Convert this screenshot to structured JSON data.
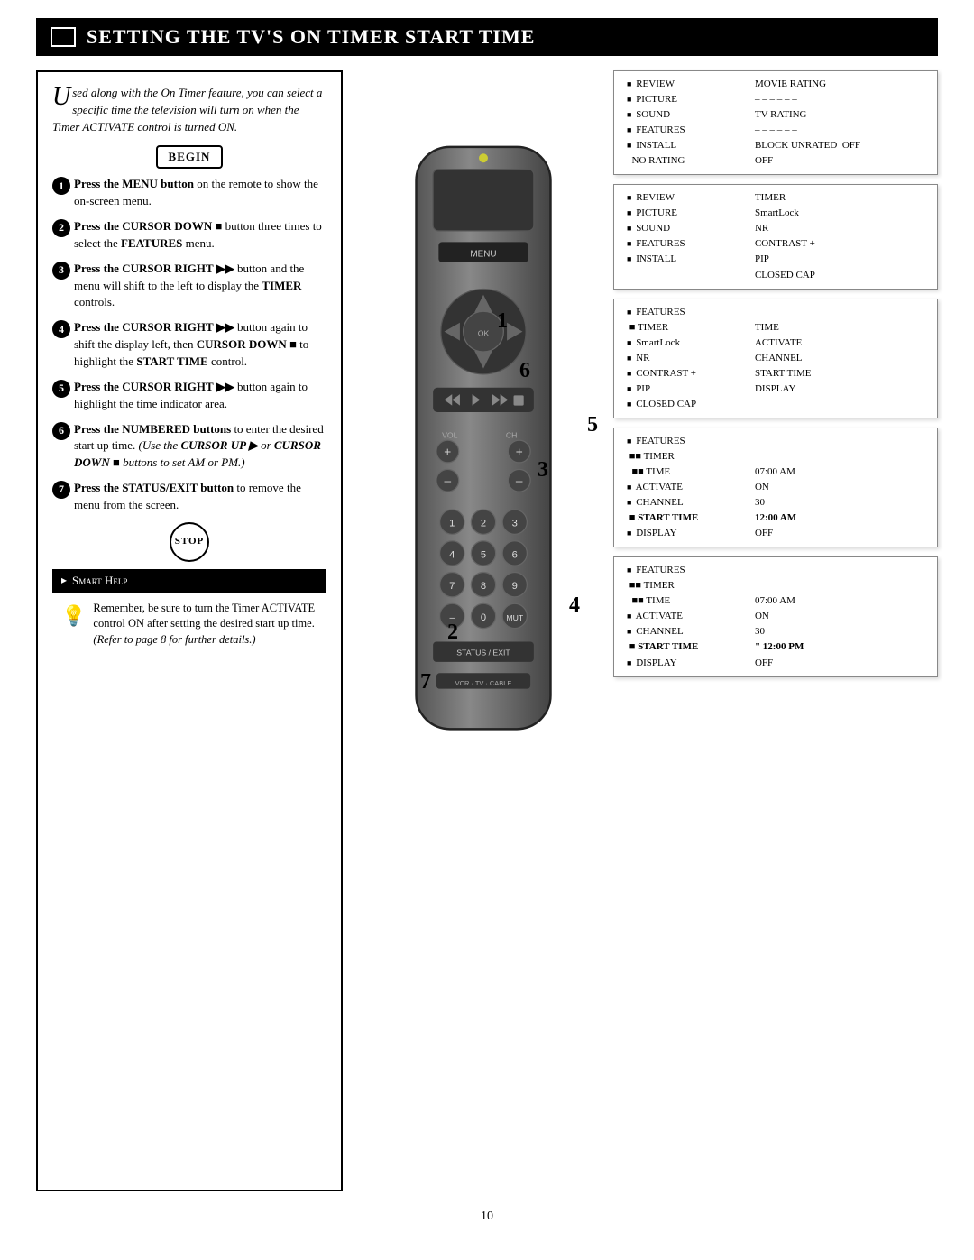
{
  "title": {
    "main": "Setting the TV's On Timer Start Time",
    "page_number": "10"
  },
  "left_panel": {
    "intro": "sed along with the On Timer feature, you can select a specific time the television will turn on when the Timer ACTIVATE control is turned ON.",
    "begin_label": "BEGIN",
    "stop_label": "STOP",
    "steps": [
      {
        "num": "1",
        "text": "Press the MENU button on the remote to show the on-screen menu."
      },
      {
        "num": "2",
        "text": "Press the CURSOR DOWN ■ button three times to select the FEATURES menu."
      },
      {
        "num": "3",
        "text": "Press the CURSOR RIGHT ▶▶ button and the menu will shift to the left to display the TIMER controls."
      },
      {
        "num": "4",
        "text": "Press the CURSOR RIGHT ▶▶ button again to shift the display left, then CURSOR DOWN ■ to highlight the START TIME control."
      },
      {
        "num": "5",
        "text": "Press the CURSOR RIGHT ▶▶ button again to highlight the time indicator area."
      },
      {
        "num": "6",
        "text": "Press the NUMBERED buttons to enter the desired start up time. (Use the CURSOR UP ▶ or CURSOR DOWN ■ buttons to set AM or PM.)"
      },
      {
        "num": "7",
        "text": "Press the STATUS/EXIT button to remove the menu from the screen."
      }
    ],
    "smart_help": {
      "title": "Smart Help",
      "text": "Remember, be sure to turn the Timer ACTIVATE control ON after setting the desired start up time.",
      "footnote": "(Refer to page 8 for further details.)"
    }
  },
  "menu_screens": [
    {
      "id": "screen1",
      "rows": [
        {
          "bullet": "■",
          "label": "REVIEW",
          "value": "MOVIE RATING"
        },
        {
          "bullet": "■",
          "label": "PICTURE",
          "value": "– – – – – –"
        },
        {
          "bullet": "■",
          "label": "SOUND",
          "value": "TV RATING"
        },
        {
          "bullet": "■",
          "label": "FEATURES",
          "value": "– – – – – –"
        },
        {
          "bullet": "■",
          "label": "INSTALL",
          "value": "BLOCK UNRATED OFF"
        },
        {
          "bullet": "",
          "label": "NO RATING",
          "value": "OFF"
        }
      ]
    },
    {
      "id": "screen2",
      "rows": [
        {
          "bullet": "■",
          "label": "REVIEW",
          "value": "TIMER"
        },
        {
          "bullet": "■",
          "label": "PICTURE",
          "value": "SmartLock"
        },
        {
          "bullet": "■",
          "label": "SOUND",
          "value": "NR"
        },
        {
          "bullet": "■",
          "label": "FEATURES",
          "value": "CONTRAST +"
        },
        {
          "bullet": "■",
          "label": "INSTALL",
          "value": "PIP"
        },
        {
          "bullet": "",
          "label": "",
          "value": "CLOSED CAP"
        }
      ]
    },
    {
      "id": "screen3",
      "rows": [
        {
          "bullet": "■",
          "label": "FEATURES",
          "value": ""
        },
        {
          "bullet": "■",
          "label": "TIMER",
          "value": "TIME"
        },
        {
          "bullet": "■",
          "label": "SmartLock",
          "value": "ACTIVATE"
        },
        {
          "bullet": "■",
          "label": "NR",
          "value": "CHANNEL"
        },
        {
          "bullet": "■",
          "label": "CONTRAST +",
          "value": "START TIME"
        },
        {
          "bullet": "■",
          "label": "PIP",
          "value": "DISPLAY"
        },
        {
          "bullet": "■",
          "label": "CLOSED CAP",
          "value": ""
        }
      ]
    },
    {
      "id": "screen4",
      "rows": [
        {
          "bullet": "■",
          "label": "FEATURES",
          "value": ""
        },
        {
          "bullet": "■■",
          "label": "TIMER",
          "value": ""
        },
        {
          "bullet": "■■",
          "label": "TIME",
          "value": "07:00 AM"
        },
        {
          "bullet": "■",
          "label": "ACTIVATE",
          "value": "ON"
        },
        {
          "bullet": "■",
          "label": "CHANNEL",
          "value": "30"
        },
        {
          "bullet": "■",
          "label": "START TIME",
          "value": "12:00 AM"
        },
        {
          "bullet": "■",
          "label": "DISPLAY",
          "value": "OFF"
        }
      ]
    },
    {
      "id": "screen5",
      "rows": [
        {
          "bullet": "■",
          "label": "FEATURES",
          "value": ""
        },
        {
          "bullet": "■■",
          "label": "TIMER",
          "value": ""
        },
        {
          "bullet": "■■",
          "label": "TIME",
          "value": "07:00 AM"
        },
        {
          "bullet": "■",
          "label": "ACTIVATE",
          "value": "ON"
        },
        {
          "bullet": "■",
          "label": "CHANNEL",
          "value": "30"
        },
        {
          "bullet": "■",
          "label": "START TIME",
          "value": "\" 12:00 PM"
        },
        {
          "bullet": "■",
          "label": "DISPLAY",
          "value": "OFF"
        }
      ]
    }
  ],
  "step_labels": [
    "1",
    "2",
    "3",
    "4",
    "5",
    "6",
    "7"
  ],
  "colors": {
    "black": "#000000",
    "white": "#ffffff",
    "gray": "#888888"
  }
}
